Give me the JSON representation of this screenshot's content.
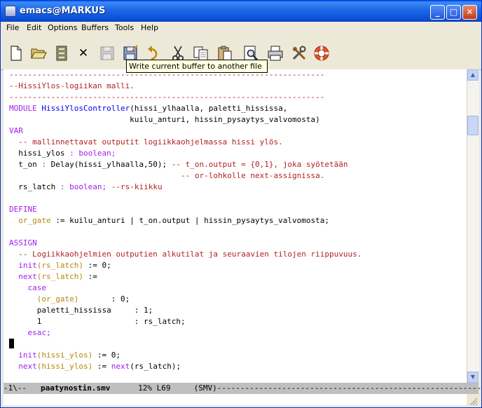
{
  "window": {
    "title": "emacs@MARKUS"
  },
  "titlebar_buttons": {
    "minimize": "_",
    "maximize": "□",
    "close": "✕"
  },
  "menu": [
    "File",
    "Edit",
    "Options",
    "Buffers",
    "Tools",
    "Help"
  ],
  "toolbar": {
    "items": [
      "new-file-icon",
      "open-folder-icon",
      "open-directory-icon",
      "close-buffer-icon",
      "save-icon",
      "write-file-icon",
      "undo-icon",
      "cut-icon",
      "copy-icon",
      "paste-icon",
      "search-icon",
      "print-icon",
      "preferences-icon",
      "help-icon"
    ],
    "close_label": "✕",
    "tooltip": "Write current buffer to another file"
  },
  "colors": {
    "keyword": "#a020f0",
    "comment": "#b22222",
    "variable": "#b8860b",
    "function": "#0000ff",
    "type": "#228b22",
    "text": "#000000"
  },
  "editor": {
    "lines": [
      [
        [
          "comment",
          "--------------------------------------------------------------------"
        ]
      ],
      [
        [
          "comment",
          "--HissiYlos-logiikan malli."
        ]
      ],
      [
        [
          "comment",
          "--------------------------------------------------------------------"
        ]
      ],
      [
        [
          "keyword",
          "MODULE"
        ],
        [
          "text",
          " "
        ],
        [
          "function",
          "HissiYlosController"
        ],
        [
          "text",
          "(hissi_ylhaalla, paletti_hississa,"
        ]
      ],
      [
        [
          "text",
          "                          kuilu_anturi, hissin_pysaytys_valvomosta)"
        ]
      ],
      [
        [
          "keyword",
          "VAR"
        ]
      ],
      [
        [
          "comment",
          "  -- mallinnettavat outputit logiikkaohjelmassa hissi ylös."
        ]
      ],
      [
        [
          "text",
          "  hissi_ylos "
        ],
        [
          "keyword",
          ": boolean;"
        ]
      ],
      [
        [
          "text",
          "  t_on "
        ],
        [
          "keyword",
          ": "
        ],
        [
          "text",
          "Delay(hissi_ylhaalla,50); "
        ],
        [
          "comment",
          "-- t_on.output = {0,1}, joka syötetään"
        ]
      ],
      [
        [
          "comment",
          "                                     -- or-lohkolle next-assignissa."
        ]
      ],
      [
        [
          "text",
          "  rs_latch "
        ],
        [
          "keyword",
          ": boolean; "
        ],
        [
          "comment",
          "--rs-kiikku"
        ]
      ],
      [
        [
          "text",
          ""
        ]
      ],
      [
        [
          "keyword",
          "DEFINE"
        ]
      ],
      [
        [
          "variable",
          "  or_gate"
        ],
        [
          "text",
          " := kuilu_anturi | t_on.output | hissin_pysaytys_valvomosta;"
        ]
      ],
      [
        [
          "text",
          ""
        ]
      ],
      [
        [
          "keyword",
          "ASSIGN"
        ]
      ],
      [
        [
          "comment",
          "  -- Logiikkaohjelmien outputien alkutilat ja seuraavien tilojen riippuvuus."
        ]
      ],
      [
        [
          "keyword",
          "  init"
        ],
        [
          "variable",
          "(rs_latch)"
        ],
        [
          "text",
          " := 0;"
        ]
      ],
      [
        [
          "keyword",
          "  next"
        ],
        [
          "variable",
          "(rs_latch)"
        ],
        [
          "text",
          " :="
        ]
      ],
      [
        [
          "keyword",
          "    case"
        ]
      ],
      [
        [
          "variable",
          "      (or_gate)"
        ],
        [
          "text",
          "       : 0;"
        ]
      ],
      [
        [
          "text",
          "      paletti_hississa     : 1;"
        ]
      ],
      [
        [
          "text",
          "      1                    : rs_latch;"
        ]
      ],
      [
        [
          "keyword",
          "    esac;"
        ]
      ],
      [
        [
          "text",
          ""
        ]
      ],
      [
        [
          "keyword",
          "  init"
        ],
        [
          "variable",
          "(hissi_ylos)"
        ],
        [
          "text",
          " := 0;"
        ]
      ],
      [
        [
          "keyword",
          "  next"
        ],
        [
          "variable",
          "(hissi_ylos)"
        ],
        [
          "text",
          " := "
        ],
        [
          "keyword",
          "next"
        ],
        [
          "text",
          "(rs_latch);"
        ]
      ]
    ]
  },
  "scrollbar": {
    "up": "▲",
    "down": "▼"
  },
  "modeline": {
    "status": "-1\\--",
    "buffer": "paatynostin.smv",
    "position": "12%",
    "line": "L69",
    "mode": "(SMV)"
  }
}
